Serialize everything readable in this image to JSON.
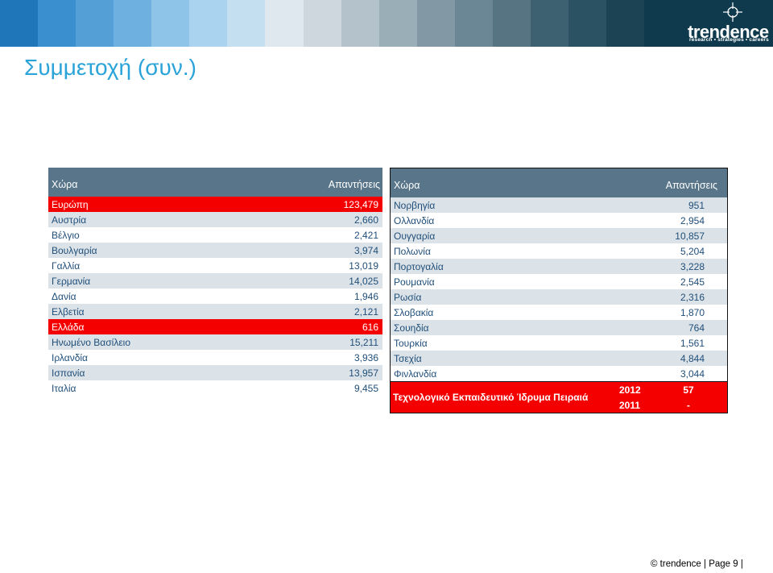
{
  "band_colors": [
    "#1f76b8",
    "#3a8fcf",
    "#539fd6",
    "#6eb0df",
    "#8ec4e8",
    "#a9d3ef",
    "#c3dff0",
    "#dfe8ee",
    "#cdd7dd",
    "#b4c3cb",
    "#9aaeb8",
    "#8299a5",
    "#6b8694",
    "#567482",
    "#3e6172",
    "#2a5263",
    "#1b4354"
  ],
  "logo": {
    "word": "trendence",
    "tagline": "research • strategies • careers"
  },
  "title": "Συμμετοχή (συν.)",
  "left_table": {
    "header": {
      "country": "Χώρα",
      "responses": "Απαντήσεις"
    },
    "rows": [
      {
        "country": "Ευρώπη",
        "value": "123,479",
        "style": "red"
      },
      {
        "country": "Αυστρία",
        "value": "2,660",
        "style": "light"
      },
      {
        "country": "Βέλγιο",
        "value": "2,421",
        "style": "white"
      },
      {
        "country": "Βουλγαρία",
        "value": "3,974",
        "style": "light"
      },
      {
        "country": "Γαλλία",
        "value": "13,019",
        "style": "white"
      },
      {
        "country": "Γερμανία",
        "value": "14,025",
        "style": "light"
      },
      {
        "country": "Δανία",
        "value": "1,946",
        "style": "white"
      },
      {
        "country": "Ελβετία",
        "value": "2,121",
        "style": "light"
      },
      {
        "country": "Ελλάδα",
        "value": "616",
        "style": "red"
      },
      {
        "country": "Ηνωμένο Βασίλειο",
        "value": "15,211",
        "style": "light"
      },
      {
        "country": "Ιρλανδία",
        "value": "3,936",
        "style": "white"
      },
      {
        "country": "Ισπανία",
        "value": "13,957",
        "style": "light"
      },
      {
        "country": "Ιταλία",
        "value": "9,455",
        "style": "white"
      }
    ]
  },
  "right_table": {
    "header": {
      "country": "Χώρα",
      "responses": "Απαντήσεις"
    },
    "rows": [
      {
        "country": "Νορβηγία",
        "value": "951",
        "style": "light"
      },
      {
        "country": "Ολλανδία",
        "value": "2,954",
        "style": "white"
      },
      {
        "country": "Ουγγαρία",
        "value": "10,857",
        "style": "light"
      },
      {
        "country": "Πολωνία",
        "value": "5,204",
        "style": "white"
      },
      {
        "country": "Πορτογαλία",
        "value": "3,228",
        "style": "light"
      },
      {
        "country": "Ρουμανία",
        "value": "2,545",
        "style": "white"
      },
      {
        "country": "Ρωσία",
        "value": "2,316",
        "style": "light"
      },
      {
        "country": "Σλοβακία",
        "value": "1,870",
        "style": "white"
      },
      {
        "country": "Σουηδία",
        "value": "764",
        "style": "light"
      },
      {
        "country": "Τουρκία",
        "value": "1,561",
        "style": "white"
      },
      {
        "country": "Τσεχία",
        "value": "4,844",
        "style": "light"
      },
      {
        "country": "Φινλανδία",
        "value": "3,044",
        "style": "white"
      }
    ],
    "highlight": {
      "name": "Τεχνολογικό Εκπαιδευτικό Ίδρυμα Πειραιά",
      "years": [
        {
          "year": "2012",
          "value": "57"
        },
        {
          "year": "2011",
          "value": "-"
        }
      ]
    }
  },
  "footer": {
    "copyright": "© trendence",
    "page": "| Page 9 |"
  }
}
